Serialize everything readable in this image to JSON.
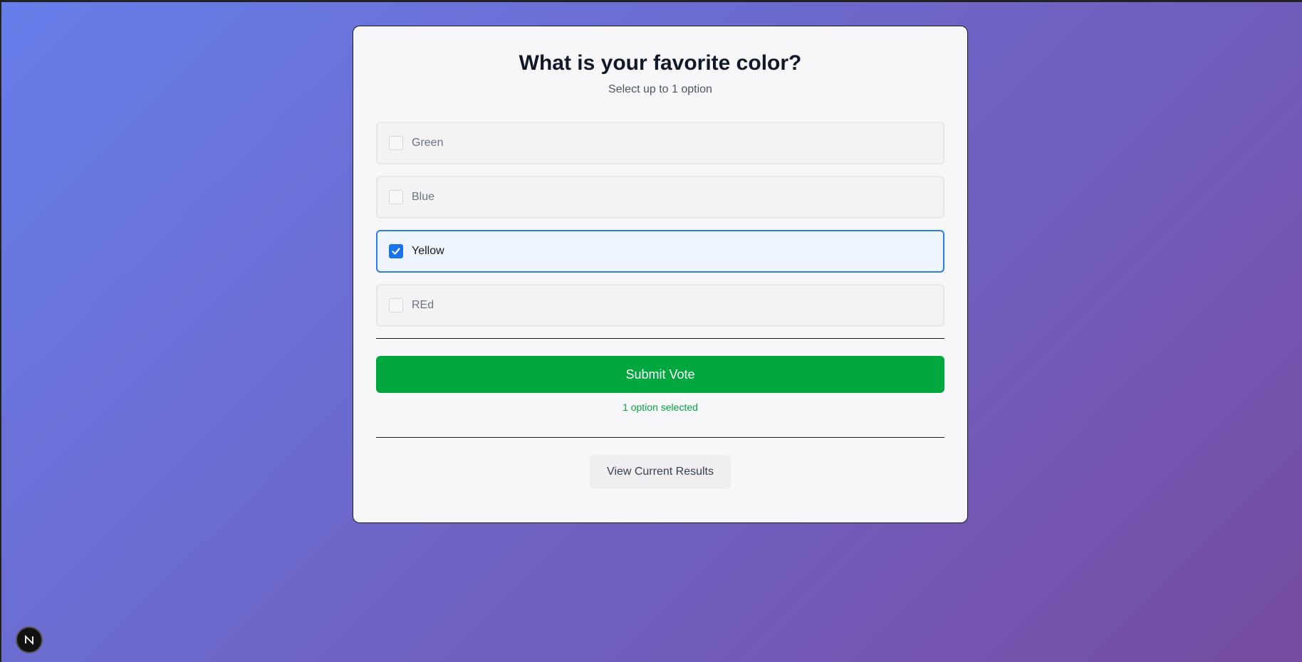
{
  "poll": {
    "title": "What is your favorite color?",
    "subtitle": "Select up to 1 option",
    "options": [
      {
        "label": "Green",
        "checked": false
      },
      {
        "label": "Blue",
        "checked": false
      },
      {
        "label": "Yellow",
        "checked": true
      },
      {
        "label": "REd",
        "checked": false
      }
    ],
    "submit_label": "Submit Vote",
    "status_text": "1 option selected",
    "results_label": "View Current Results"
  },
  "colors": {
    "background_start": "#667eea",
    "background_end": "#764ba2",
    "accent_blue": "#1a73e8",
    "submit_green": "#00a63e"
  },
  "icons": {
    "checkbox_checked": "checkmark-icon",
    "badge": "nextjs-logo-icon"
  }
}
